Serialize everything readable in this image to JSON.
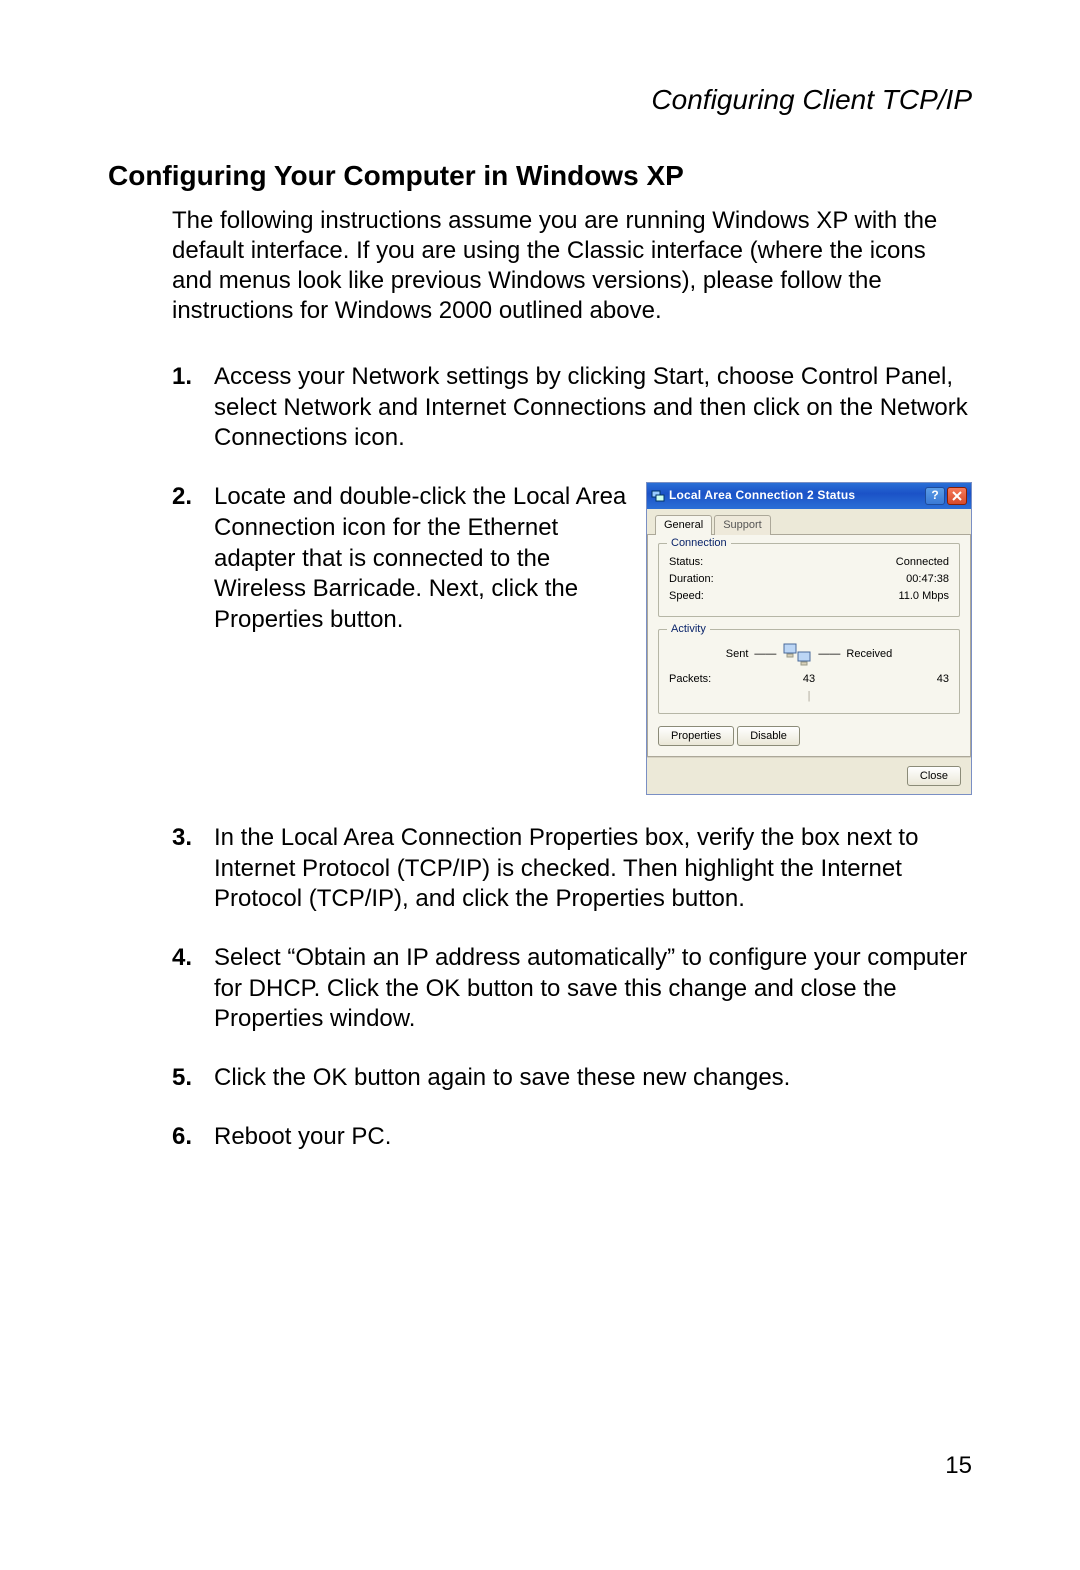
{
  "running_head": "Configuring Client TCP/IP",
  "heading": "Configuring Your Computer in Windows XP",
  "intro": "The following instructions assume you are running Windows XP with the default interface. If you are using the Classic interface (where the icons and menus look like previous Windows versions), please follow the instructions for Windows 2000 outlined above.",
  "steps": {
    "s1_num": "1.",
    "s1": "Access your Network settings by clicking Start, choose Control Panel, select Network and Internet Connections and then click on the Network Connections icon.",
    "s2_num": "2.",
    "s2": "Locate and double-click the Local Area Connection icon for the Ethernet adapter that is connected to the Wireless Barricade. Next, click the Properties button.",
    "s3_num": "3.",
    "s3": "In the Local Area Connection Properties box, verify the box next to Internet Protocol (TCP/IP) is checked. Then highlight the Internet Protocol (TCP/IP), and click the Properties button.",
    "s4_num": "4.",
    "s4": "Select “Obtain an IP address automatically” to configure your computer for DHCP. Click the OK button to save this change and close the Properties window.",
    "s5_num": "5.",
    "s5": "Click the OK button again to save these new changes.",
    "s6_num": "6.",
    "s6": "Reboot your PC."
  },
  "page_number": "15",
  "xp": {
    "title": "Local Area Connection 2 Status",
    "tabs": {
      "general": "General",
      "support": "Support"
    },
    "connection": {
      "legend": "Connection",
      "status_label": "Status:",
      "status_value": "Connected",
      "duration_label": "Duration:",
      "duration_value": "00:47:38",
      "speed_label": "Speed:",
      "speed_value": "11.0 Mbps"
    },
    "activity": {
      "legend": "Activity",
      "sent_label": "Sent",
      "received_label": "Received",
      "packets_label": "Packets:",
      "sent_value": "43",
      "received_value": "43"
    },
    "buttons": {
      "properties": "Properties",
      "disable": "Disable",
      "close": "Close"
    }
  }
}
